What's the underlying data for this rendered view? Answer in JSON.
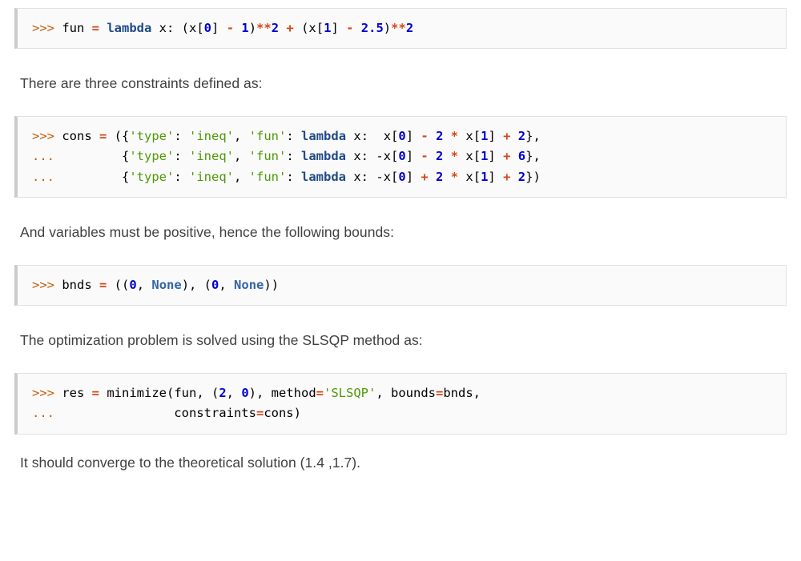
{
  "document": {
    "type": "scipy-doctest-excerpt",
    "colors": {
      "background": "#ffffff",
      "code_background": "#fafafa",
      "code_border": "#e1e1e1",
      "code_left_accent": "#cbcbcb",
      "prose_text": "#404040",
      "prompt": "#c65d09",
      "operator": "#d2491b",
      "keyword": "#204a87",
      "constant": "#3465a4",
      "number": "#0000cf",
      "string": "#4e9a06",
      "plain": "#000000"
    }
  },
  "blocks": [
    {
      "kind": "code",
      "name": "objective-function-code-block",
      "lines": [
        {
          "tokens": [
            {
              "t": "prompt",
              "s": ">>> "
            },
            {
              "t": "name",
              "s": "fun "
            },
            {
              "t": "op",
              "s": "="
            },
            {
              "t": "name",
              "s": " "
            },
            {
              "t": "kw",
              "s": "lambda"
            },
            {
              "t": "name",
              "s": " x: (x["
            },
            {
              "t": "num",
              "s": "0"
            },
            {
              "t": "name",
              "s": "] "
            },
            {
              "t": "op",
              "s": "-"
            },
            {
              "t": "name",
              "s": " "
            },
            {
              "t": "num",
              "s": "1"
            },
            {
              "t": "punct",
              "s": ")"
            },
            {
              "t": "op",
              "s": "**"
            },
            {
              "t": "num",
              "s": "2"
            },
            {
              "t": "name",
              "s": " "
            },
            {
              "t": "op",
              "s": "+"
            },
            {
              "t": "name",
              "s": " (x["
            },
            {
              "t": "num",
              "s": "1"
            },
            {
              "t": "name",
              "s": "] "
            },
            {
              "t": "op",
              "s": "-"
            },
            {
              "t": "name",
              "s": " "
            },
            {
              "t": "num",
              "s": "2.5"
            },
            {
              "t": "punct",
              "s": ")"
            },
            {
              "t": "op",
              "s": "**"
            },
            {
              "t": "num",
              "s": "2"
            }
          ],
          "plain": ">>> fun = lambda x: (x[0] - 1)**2 + (x[1] - 2.5)**2"
        }
      ]
    },
    {
      "kind": "prose",
      "name": "constraints-intro-paragraph",
      "text": "There are three constraints defined as:"
    },
    {
      "kind": "code",
      "name": "constraints-code-block",
      "lines": [
        {
          "tokens": [
            {
              "t": "prompt",
              "s": ">>> "
            },
            {
              "t": "name",
              "s": "cons "
            },
            {
              "t": "op",
              "s": "="
            },
            {
              "t": "name",
              "s": " ({"
            },
            {
              "t": "str",
              "s": "'type'"
            },
            {
              "t": "name",
              "s": ": "
            },
            {
              "t": "str",
              "s": "'ineq'"
            },
            {
              "t": "name",
              "s": ", "
            },
            {
              "t": "str",
              "s": "'fun'"
            },
            {
              "t": "name",
              "s": ": "
            },
            {
              "t": "kw",
              "s": "lambda"
            },
            {
              "t": "name",
              "s": " x:  x["
            },
            {
              "t": "num",
              "s": "0"
            },
            {
              "t": "name",
              "s": "] "
            },
            {
              "t": "op",
              "s": "-"
            },
            {
              "t": "name",
              "s": " "
            },
            {
              "t": "num",
              "s": "2"
            },
            {
              "t": "name",
              "s": " "
            },
            {
              "t": "op",
              "s": "*"
            },
            {
              "t": "name",
              "s": " x["
            },
            {
              "t": "num",
              "s": "1"
            },
            {
              "t": "name",
              "s": "] "
            },
            {
              "t": "op",
              "s": "+"
            },
            {
              "t": "name",
              "s": " "
            },
            {
              "t": "num",
              "s": "2"
            },
            {
              "t": "name",
              "s": "},"
            }
          ],
          "plain": ">>> cons = ({'type': 'ineq', 'fun': lambda x:  x[0] - 2 * x[1] + 2},"
        },
        {
          "tokens": [
            {
              "t": "prompt",
              "s": "... "
            },
            {
              "t": "name",
              "s": "        {"
            },
            {
              "t": "str",
              "s": "'type'"
            },
            {
              "t": "name",
              "s": ": "
            },
            {
              "t": "str",
              "s": "'ineq'"
            },
            {
              "t": "name",
              "s": ", "
            },
            {
              "t": "str",
              "s": "'fun'"
            },
            {
              "t": "name",
              "s": ": "
            },
            {
              "t": "kw",
              "s": "lambda"
            },
            {
              "t": "name",
              "s": " x: -x["
            },
            {
              "t": "num",
              "s": "0"
            },
            {
              "t": "name",
              "s": "] "
            },
            {
              "t": "op",
              "s": "-"
            },
            {
              "t": "name",
              "s": " "
            },
            {
              "t": "num",
              "s": "2"
            },
            {
              "t": "name",
              "s": " "
            },
            {
              "t": "op",
              "s": "*"
            },
            {
              "t": "name",
              "s": " x["
            },
            {
              "t": "num",
              "s": "1"
            },
            {
              "t": "name",
              "s": "] "
            },
            {
              "t": "op",
              "s": "+"
            },
            {
              "t": "name",
              "s": " "
            },
            {
              "t": "num",
              "s": "6"
            },
            {
              "t": "name",
              "s": "},"
            }
          ],
          "plain": "...         {'type': 'ineq', 'fun': lambda x: -x[0] - 2 * x[1] + 6},"
        },
        {
          "tokens": [
            {
              "t": "prompt",
              "s": "... "
            },
            {
              "t": "name",
              "s": "        {"
            },
            {
              "t": "str",
              "s": "'type'"
            },
            {
              "t": "name",
              "s": ": "
            },
            {
              "t": "str",
              "s": "'ineq'"
            },
            {
              "t": "name",
              "s": ", "
            },
            {
              "t": "str",
              "s": "'fun'"
            },
            {
              "t": "name",
              "s": ": "
            },
            {
              "t": "kw",
              "s": "lambda"
            },
            {
              "t": "name",
              "s": " x: -x["
            },
            {
              "t": "num",
              "s": "0"
            },
            {
              "t": "name",
              "s": "] "
            },
            {
              "t": "op",
              "s": "+"
            },
            {
              "t": "name",
              "s": " "
            },
            {
              "t": "num",
              "s": "2"
            },
            {
              "t": "name",
              "s": " "
            },
            {
              "t": "op",
              "s": "*"
            },
            {
              "t": "name",
              "s": " x["
            },
            {
              "t": "num",
              "s": "1"
            },
            {
              "t": "name",
              "s": "] "
            },
            {
              "t": "op",
              "s": "+"
            },
            {
              "t": "name",
              "s": " "
            },
            {
              "t": "num",
              "s": "2"
            },
            {
              "t": "name",
              "s": "})"
            }
          ],
          "plain": "...         {'type': 'ineq', 'fun': lambda x: -x[0] + 2 * x[1] + 2})"
        }
      ]
    },
    {
      "kind": "prose",
      "name": "bounds-intro-paragraph",
      "text": "And variables must be positive, hence the following bounds:"
    },
    {
      "kind": "code",
      "name": "bounds-code-block",
      "lines": [
        {
          "tokens": [
            {
              "t": "prompt",
              "s": ">>> "
            },
            {
              "t": "name",
              "s": "bnds "
            },
            {
              "t": "op",
              "s": "="
            },
            {
              "t": "name",
              "s": " (("
            },
            {
              "t": "num",
              "s": "0"
            },
            {
              "t": "name",
              "s": ", "
            },
            {
              "t": "const",
              "s": "None"
            },
            {
              "t": "name",
              "s": "), ("
            },
            {
              "t": "num",
              "s": "0"
            },
            {
              "t": "name",
              "s": ", "
            },
            {
              "t": "const",
              "s": "None"
            },
            {
              "t": "name",
              "s": "))"
            }
          ],
          "plain": ">>> bnds = ((0, None), (0, None))"
        }
      ]
    },
    {
      "kind": "prose",
      "name": "solver-intro-paragraph",
      "text": "The optimization problem is solved using the SLSQP method as:"
    },
    {
      "kind": "code",
      "name": "minimize-call-code-block",
      "lines": [
        {
          "tokens": [
            {
              "t": "prompt",
              "s": ">>> "
            },
            {
              "t": "name",
              "s": "res "
            },
            {
              "t": "op",
              "s": "="
            },
            {
              "t": "name",
              "s": " minimize(fun, ("
            },
            {
              "t": "num",
              "s": "2"
            },
            {
              "t": "name",
              "s": ", "
            },
            {
              "t": "num",
              "s": "0"
            },
            {
              "t": "name",
              "s": "), method"
            },
            {
              "t": "op",
              "s": "="
            },
            {
              "t": "str",
              "s": "'SLSQP'"
            },
            {
              "t": "name",
              "s": ", bounds"
            },
            {
              "t": "op",
              "s": "="
            },
            {
              "t": "name",
              "s": "bnds,"
            }
          ],
          "plain": ">>> res = minimize(fun, (2, 0), method='SLSQP', bounds=bnds,"
        },
        {
          "tokens": [
            {
              "t": "prompt",
              "s": "... "
            },
            {
              "t": "name",
              "s": "               constraints"
            },
            {
              "t": "op",
              "s": "="
            },
            {
              "t": "name",
              "s": "cons)"
            }
          ],
          "plain": "...                constraints=cons)"
        }
      ]
    },
    {
      "kind": "prose",
      "name": "conclusion-paragraph",
      "text": "It should converge to the theoretical solution (1.4 ,1.7)."
    }
  ]
}
